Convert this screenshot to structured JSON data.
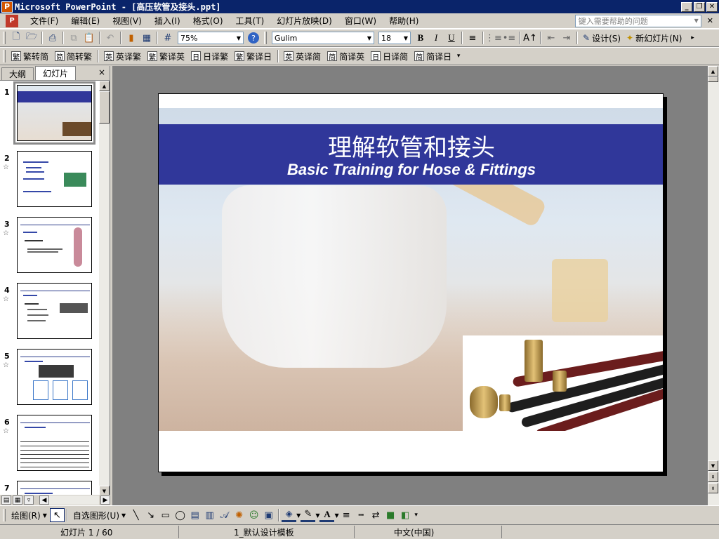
{
  "window": {
    "title": "Microsoft PowerPoint - [高压软管及接头.ppt]",
    "app_icon": "powerpoint-icon"
  },
  "menu": {
    "items": [
      "文件(F)",
      "编辑(E)",
      "视图(V)",
      "插入(I)",
      "格式(O)",
      "工具(T)",
      "幻灯片放映(D)",
      "窗口(W)",
      "帮助(H)"
    ],
    "help_placeholder": "键入需要帮助的问题"
  },
  "toolbar": {
    "zoom": "75%",
    "font": "Gulim",
    "font_size": "18",
    "bold": "B",
    "italic": "I",
    "underline": "U",
    "design_label": "设计(S)",
    "new_slide_label": "新幻灯片(N)"
  },
  "translation_bar": {
    "items": [
      {
        "chip": "繁",
        "label": "繁转简"
      },
      {
        "chip": "简",
        "label": "简转繁"
      },
      {
        "chip": "英",
        "label": "英译繁"
      },
      {
        "chip": "繁",
        "label": "繁译英"
      },
      {
        "chip": "日",
        "label": "日译繁"
      },
      {
        "chip": "繁",
        "label": "繁译日"
      },
      {
        "chip": "英",
        "label": "英译简"
      },
      {
        "chip": "简",
        "label": "简译英"
      },
      {
        "chip": "日",
        "label": "日译简"
      },
      {
        "chip": "简",
        "label": "简译日"
      }
    ]
  },
  "left_pane": {
    "tabs": [
      "大纲",
      "幻灯片"
    ],
    "active_tab": "幻灯片",
    "close": "×",
    "thumbnails": [
      "1",
      "2",
      "3",
      "4",
      "5",
      "6",
      "7"
    ],
    "star": "☆"
  },
  "slide": {
    "title_cn": "理解软管和接头",
    "title_en": "Basic Training for Hose & Fittings",
    "band_color": "#30379a"
  },
  "drawing_toolbar": {
    "draw_label": "绘图(R)",
    "autoshape_label": "自选图形(U)"
  },
  "status": {
    "slide_pos": "幻灯片 1 / 60",
    "template": "1_默认设计模板",
    "language": "中文(中国)"
  }
}
